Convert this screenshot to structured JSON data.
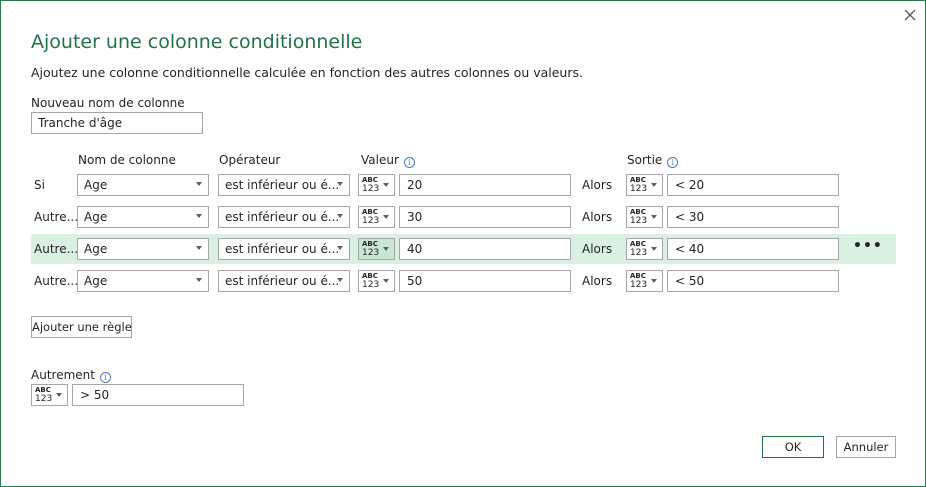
{
  "dialog": {
    "title": "Ajouter une colonne conditionnelle",
    "subtitle": "Ajoutez une colonne conditionnelle calculée en fonction des autres colonnes ou valeurs.",
    "new_column_label": "Nouveau nom de colonne",
    "new_column_value": "Tranche d'âge"
  },
  "headers": {
    "column_name": "Nom de colonne",
    "operator": "Opérateur",
    "value": "Valeur",
    "output": "Sortie"
  },
  "type_icon": {
    "line1": "ABC",
    "line2": "123"
  },
  "alors_label": "Alors",
  "rules": [
    {
      "label": "Si",
      "column": "Age",
      "operator": "est inférieur ou é...",
      "value": "20",
      "output": "< 20",
      "selected": false
    },
    {
      "label": "Autre...",
      "column": "Age",
      "operator": "est inférieur ou é...",
      "value": "30",
      "output": "< 30",
      "selected": false
    },
    {
      "label": "Autre...",
      "column": "Age",
      "operator": "est inférieur ou é...",
      "value": "40",
      "output": "< 40",
      "selected": true
    },
    {
      "label": "Autre...",
      "column": "Age",
      "operator": "est inférieur ou é...",
      "value": "50",
      "output": "< 50",
      "selected": false
    }
  ],
  "more_glyph": "•••",
  "add_rule_label": "Ajouter une règle",
  "otherwise": {
    "label": "Autrement",
    "value": "> 50"
  },
  "buttons": {
    "ok": "OK",
    "cancel": "Annuler"
  },
  "colors": {
    "accent": "#217346",
    "selected_row": "#d9f0e3",
    "info": "#4a7dbd"
  }
}
